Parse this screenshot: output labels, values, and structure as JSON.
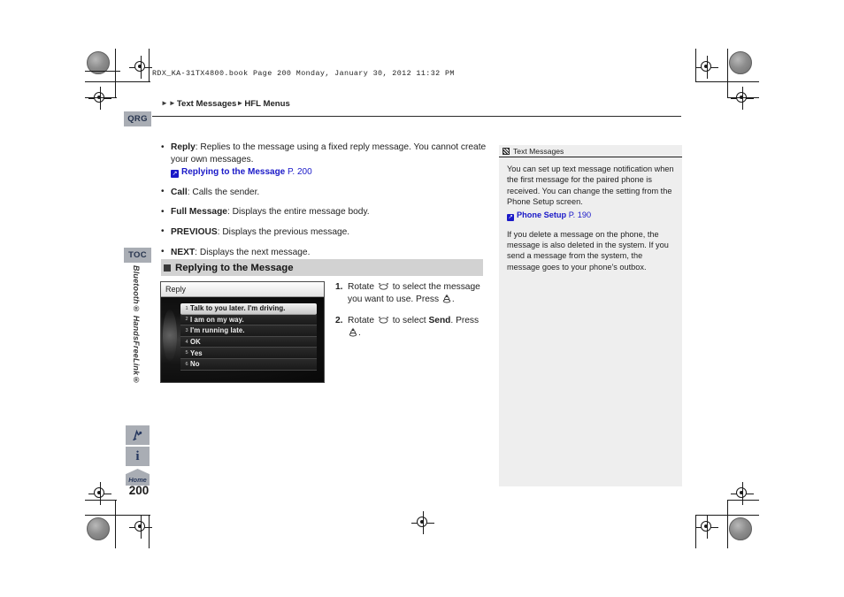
{
  "print": {
    "book_info": "RDX_KA-31TX4800.book  Page 200  Monday, January 30, 2012  11:32 PM"
  },
  "header": {
    "breadcrumb_parts": [
      "Text Messages",
      "HFL Menus"
    ],
    "breadcrumb": "Text Messages HFL Menus"
  },
  "sidebar": {
    "tabs": [
      {
        "label": "QRG",
        "name": "quick-reference-guide"
      },
      {
        "label": "TOC",
        "name": "table-of-contents"
      }
    ],
    "vertical_label": "Bluetooth",
    "vertical_label_2": "HandsFreeLink",
    "vertical_label_full": "Bluetooth® HandsFreeLink®",
    "icons": [
      {
        "name": "navigation-icon",
        "glyph": "navigation"
      },
      {
        "name": "info-icon",
        "glyph": "i"
      }
    ],
    "home_label": "Home",
    "page_number": "200"
  },
  "main": {
    "bullets": [
      {
        "term": "Reply",
        "text": ": Replies to the message using a fixed reply message. You cannot create your own messages.",
        "xref": {
          "label": "Replying to the Message",
          "page": "P. 200"
        }
      },
      {
        "term": "Call",
        "text": ": Calls the sender."
      },
      {
        "term": "Full Message",
        "text": ": Displays the entire message body."
      },
      {
        "term": "PREVIOUS",
        "text": ": Displays the previous message."
      },
      {
        "term": "NEXT",
        "text": ": Displays the next message."
      }
    ],
    "section_title": "Replying to the Message",
    "screen": {
      "title": "Reply",
      "items": [
        {
          "num": "1",
          "text": "Talk to you later. I'm driving.",
          "selected": true
        },
        {
          "num": "2",
          "text": "I am on my way.",
          "selected": false
        },
        {
          "num": "3",
          "text": "I'm running late.",
          "selected": false
        },
        {
          "num": "4",
          "text": "OK",
          "selected": false
        },
        {
          "num": "5",
          "text": "Yes",
          "selected": false
        },
        {
          "num": "6",
          "text": "No",
          "selected": false
        }
      ]
    },
    "steps": [
      {
        "num": "1.",
        "part1": "Rotate",
        "part2": "to select the message you want to use. Press",
        "part3": "."
      },
      {
        "num": "2.",
        "part1": "Rotate",
        "part2": "to select",
        "bold": "Send",
        "part3": ". Press",
        "part4": "."
      }
    ]
  },
  "note": {
    "title": "Text Messages",
    "paragraph1": "You can set up text message notification when the first message for the paired phone is received. You can change the setting from the Phone Setup screen.",
    "xref": {
      "label": "Phone Setup",
      "page": "P. 190"
    },
    "paragraph2": "If you delete a message on the phone, the message is also deleted in the system. If you send a message from the system, the message goes to your phone's outbox."
  },
  "colors": {
    "link": "#1a19c8",
    "tab_bg": "#a9adb4",
    "tab_text": "#26334d",
    "section_bar": "#d2d2d2",
    "note_bg": "#eeeeee"
  }
}
